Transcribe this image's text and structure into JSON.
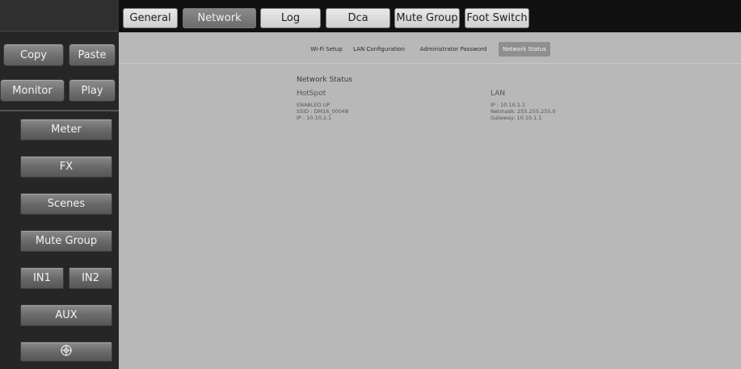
{
  "top_tabs": [
    {
      "label": "General"
    },
    {
      "label": "Network"
    },
    {
      "label": "Log"
    },
    {
      "label": "Dca"
    },
    {
      "label": "Mute Group"
    },
    {
      "label": "Foot Switch"
    }
  ],
  "active_top_tab": "Network",
  "sidebar": {
    "copy_label": "Copy",
    "paste_label": "Paste",
    "monitor_label": "Monitor",
    "play_label": "Play",
    "meter_label": "Meter",
    "fx_label": "FX",
    "scenes_label": "Scenes",
    "mute_group_label": "Mute Group",
    "in1_label": "IN1",
    "in2_label": "IN2",
    "aux_label": "AUX",
    "bottom_icon": "crosshair-icon"
  },
  "sub_tabs": [
    {
      "label": "Wi-Fi Setup"
    },
    {
      "label": "LAN Configuration"
    },
    {
      "label": "Administrator Password"
    },
    {
      "label": "Network Status"
    }
  ],
  "active_sub_tab": "Network Status",
  "network_status": {
    "heading": "Network Status",
    "hotspot": {
      "title": "HotSpot",
      "status": "ENABLED UP",
      "ssid": "SSID : DM16_00048",
      "ip": "IP : 10.10.2.1"
    },
    "lan": {
      "title": "LAN",
      "ip": "IP : 10.10.1.1",
      "netmask": "Netmask: 255.255.255.0",
      "gateway": "Gateway: 10.10.1.1"
    }
  },
  "colors": {
    "panel": "#b8b8b8",
    "sidebar": "#262626",
    "button": "#7a7a7a",
    "active_tab": "#7a7a7a",
    "tab": "#dedede"
  }
}
